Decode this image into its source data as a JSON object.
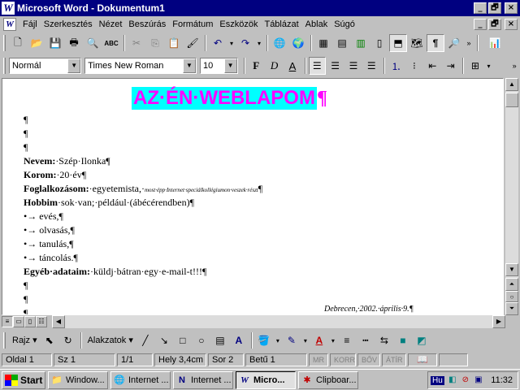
{
  "window": {
    "title": "Microsoft Word - Dokumentum1",
    "minimize": "_",
    "maximize": "🗗",
    "close": "×"
  },
  "menu": [
    "Fájl",
    "Szerkesztés",
    "Nézet",
    "Beszúrás",
    "Formátum",
    "Eszközök",
    "Táblázat",
    "Ablak",
    "Súgó"
  ],
  "format_toolbar": {
    "style": "Normál",
    "font": "Times New Roman",
    "size": "10",
    "bold": "F",
    "italic": "D",
    "underline": "A"
  },
  "document": {
    "heading": "AZ·ÉN·WEBLAPOM",
    "pilcrow": "¶",
    "name_label": "Nevem:",
    "name_value": "·Szép·Ilonka¶",
    "age_label": "Korom:",
    "age_value": "·20·év¶",
    "job_label": "Foglalkozásom:",
    "job_value": "·egyetemista,·",
    "job_note": "most·épp·Internet·speciálkollégiumon·veszek·részt",
    "job_end": "¶",
    "hobby_label": "Hobbim",
    "hobby_value": "·sok·van;·például·(ábécérendben)¶",
    "bullets": [
      "evés,¶",
      "olvasás,¶",
      "tanulás,¶",
      "táncolás.¶"
    ],
    "bullet_mark": "•→",
    "other_label": "Egyéb·adataim:",
    "other_value": "·küldj·bátran·egy·e-mail-t!!!¶",
    "footer": "Debrecen,·2002.·április·9.¶"
  },
  "drawing_toolbar": {
    "draw": "Rajz",
    "autoshapes": "Alakzatok"
  },
  "status": {
    "page": "Oldal  1",
    "section": "Sz  1",
    "pages": "1/1",
    "position": "Hely  3,4cm",
    "line": "Sor  2",
    "column": "Betű  1",
    "rec": "MR",
    "trk": "KORR",
    "ext": "BŐV",
    "ovr": "ÁTÍR"
  },
  "taskbar": {
    "start": "Start",
    "tasks": [
      "Window...",
      "Internet ...",
      "Internet ...",
      "Micro...",
      "Clipboar..."
    ],
    "lang": "Hu",
    "clock": "11:32"
  }
}
